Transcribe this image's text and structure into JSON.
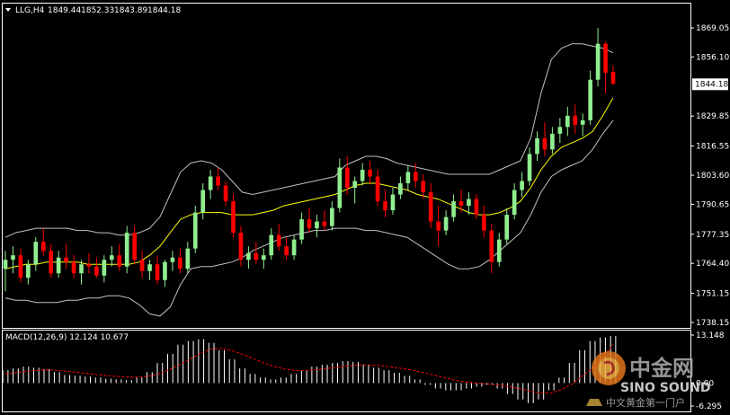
{
  "header": {
    "symbol": "LLG,H4",
    "open": "1849.44",
    "high": "1852.33",
    "low": "1843.89",
    "close": "1844.18"
  },
  "price_axis": {
    "ticks": [
      "1869.05",
      "1856.10",
      "1829.85",
      "1816.55",
      "1803.60",
      "1790.65",
      "1777.35",
      "1764.40",
      "1751.15",
      "1738.15"
    ],
    "current_price_label": "1844.18"
  },
  "macd_panel": {
    "title": "MACD(12,26,9) 12.124 10.677",
    "ticks": [
      "13.148",
      "0.00",
      "-6.295"
    ]
  },
  "watermark": {
    "cn_name": "中金网",
    "en_name": "SINO SOUND",
    "slogan": "中文黄金第一门户"
  },
  "colors": {
    "background": "#000000",
    "bull_candle": "#90ee90",
    "bear_candle": "#ff0000",
    "bollinger": "#c0c0c0",
    "moving_average": "#ffff00",
    "macd_hist": "#ffffff",
    "macd_signal": "#ff0000",
    "axis_text": "#ffffff",
    "current_price_box": "#ffffff"
  },
  "chart_data": {
    "type": "candlestick",
    "price_ylim": [
      1738.15,
      1869.05
    ],
    "ohlc": [
      [
        1762,
        1770,
        1752,
        1766
      ],
      [
        1766,
        1772,
        1760,
        1768
      ],
      [
        1768,
        1771,
        1756,
        1758
      ],
      [
        1758,
        1766,
        1755,
        1764
      ],
      [
        1764,
        1776,
        1761,
        1774
      ],
      [
        1774,
        1780,
        1768,
        1770
      ],
      [
        1770,
        1773,
        1758,
        1760
      ],
      [
        1760,
        1770,
        1758,
        1767
      ],
      [
        1767,
        1773,
        1762,
        1765
      ],
      [
        1765,
        1768,
        1758,
        1760
      ],
      [
        1760,
        1766,
        1755,
        1764
      ],
      [
        1764,
        1769,
        1760,
        1763
      ],
      [
        1763,
        1767,
        1758,
        1759
      ],
      [
        1759,
        1768,
        1756,
        1766
      ],
      [
        1766,
        1772,
        1763,
        1768
      ],
      [
        1768,
        1773,
        1761,
        1763
      ],
      [
        1763,
        1781,
        1760,
        1778
      ],
      [
        1778,
        1781,
        1764,
        1766
      ],
      [
        1766,
        1770,
        1758,
        1761
      ],
      [
        1761,
        1766,
        1757,
        1764
      ],
      [
        1764,
        1768,
        1755,
        1757
      ],
      [
        1757,
        1766,
        1754,
        1765
      ],
      [
        1765,
        1770,
        1761,
        1767
      ],
      [
        1767,
        1771,
        1760,
        1762
      ],
      [
        1762,
        1774,
        1760,
        1771
      ],
      [
        1771,
        1790,
        1769,
        1787
      ],
      [
        1787,
        1800,
        1784,
        1797
      ],
      [
        1797,
        1806,
        1793,
        1803
      ],
      [
        1803,
        1807,
        1797,
        1799
      ],
      [
        1799,
        1801,
        1790,
        1792
      ],
      [
        1792,
        1795,
        1776,
        1778
      ],
      [
        1778,
        1781,
        1763,
        1766
      ],
      [
        1766,
        1772,
        1762,
        1769
      ],
      [
        1769,
        1774,
        1764,
        1766
      ],
      [
        1766,
        1771,
        1762,
        1768
      ],
      [
        1768,
        1780,
        1766,
        1777
      ],
      [
        1777,
        1782,
        1770,
        1772
      ],
      [
        1772,
        1776,
        1766,
        1768
      ],
      [
        1768,
        1777,
        1766,
        1775
      ],
      [
        1775,
        1787,
        1773,
        1784
      ],
      [
        1784,
        1789,
        1778,
        1780
      ],
      [
        1780,
        1786,
        1776,
        1783
      ],
      [
        1783,
        1788,
        1779,
        1781
      ],
      [
        1781,
        1792,
        1779,
        1789
      ],
      [
        1789,
        1811,
        1787,
        1807
      ],
      [
        1807,
        1812,
        1795,
        1798
      ],
      [
        1798,
        1803,
        1791,
        1801
      ],
      [
        1801,
        1809,
        1799,
        1806
      ],
      [
        1806,
        1810,
        1800,
        1803
      ],
      [
        1803,
        1806,
        1790,
        1792
      ],
      [
        1792,
        1797,
        1785,
        1788
      ],
      [
        1788,
        1798,
        1786,
        1795
      ],
      [
        1795,
        1803,
        1793,
        1800
      ],
      [
        1800,
        1808,
        1797,
        1805
      ],
      [
        1805,
        1809,
        1798,
        1801
      ],
      [
        1801,
        1804,
        1793,
        1796
      ],
      [
        1796,
        1800,
        1780,
        1783
      ],
      [
        1783,
        1790,
        1772,
        1779
      ],
      [
        1779,
        1788,
        1777,
        1785
      ],
      [
        1785,
        1795,
        1783,
        1792
      ],
      [
        1792,
        1797,
        1787,
        1790
      ],
      [
        1790,
        1796,
        1786,
        1793
      ],
      [
        1793,
        1795,
        1784,
        1786
      ],
      [
        1786,
        1790,
        1776,
        1779
      ],
      [
        1779,
        1782,
        1760,
        1765
      ],
      [
        1765,
        1778,
        1763,
        1775
      ],
      [
        1775,
        1789,
        1773,
        1786
      ],
      [
        1786,
        1800,
        1784,
        1797
      ],
      [
        1797,
        1805,
        1794,
        1801
      ],
      [
        1801,
        1816,
        1799,
        1813
      ],
      [
        1813,
        1823,
        1810,
        1820
      ],
      [
        1820,
        1827,
        1812,
        1815
      ],
      [
        1815,
        1825,
        1813,
        1822
      ],
      [
        1822,
        1829,
        1818,
        1825
      ],
      [
        1825,
        1834,
        1821,
        1830
      ],
      [
        1830,
        1835,
        1822,
        1826
      ],
      [
        1826,
        1831,
        1821,
        1828
      ],
      [
        1828,
        1850,
        1826,
        1846
      ],
      [
        1846,
        1869,
        1843,
        1862
      ],
      [
        1862,
        1863,
        1840,
        1849
      ],
      [
        1849.44,
        1852.33,
        1843.89,
        1844.18
      ]
    ],
    "bollinger_upper": [
      1776,
      1778,
      1779,
      1780,
      1780,
      1780,
      1780,
      1779,
      1779,
      1778,
      1778,
      1777,
      1777,
      1778,
      1780,
      1785,
      1795,
      1805,
      1809,
      1810,
      1809,
      1806,
      1801,
      1796,
      1795,
      1796,
      1797,
      1798,
      1799,
      1800,
      1801,
      1802,
      1803,
      1808,
      1810,
      1812,
      1812,
      1811,
      1809,
      1808,
      1807,
      1806,
      1805,
      1804,
      1804,
      1804,
      1804,
      1804,
      1806,
      1808,
      1810,
      1820,
      1840,
      1855,
      1860,
      1862,
      1862,
      1861,
      1860,
      1858
    ],
    "bollinger_lower": [
      1749,
      1748,
      1748,
      1747,
      1747,
      1747,
      1748,
      1748,
      1749,
      1749,
      1750,
      1750,
      1749,
      1746,
      1742,
      1741,
      1745,
      1755,
      1762,
      1763,
      1763,
      1764,
      1765,
      1767,
      1770,
      1772,
      1774,
      1776,
      1777,
      1778,
      1779,
      1779,
      1780,
      1780,
      1780,
      1779,
      1779,
      1778,
      1777,
      1776,
      1773,
      1770,
      1767,
      1764,
      1762,
      1762,
      1763,
      1766,
      1770,
      1774,
      1778,
      1786,
      1796,
      1803,
      1806,
      1808,
      1810,
      1815,
      1822,
      1828
    ],
    "moving_average": [
      1762,
      1763,
      1764,
      1764,
      1765,
      1765,
      1765,
      1765,
      1764,
      1764,
      1764,
      1764,
      1764,
      1765,
      1768,
      1772,
      1778,
      1784,
      1786,
      1787,
      1787,
      1787,
      1786,
      1786,
      1786,
      1787,
      1788,
      1790,
      1791,
      1792,
      1793,
      1794,
      1795,
      1797,
      1799,
      1800,
      1800,
      1799,
      1798,
      1797,
      1795,
      1794,
      1793,
      1791,
      1789,
      1787,
      1786,
      1786,
      1787,
      1789,
      1792,
      1798,
      1806,
      1812,
      1816,
      1818,
      1820,
      1823,
      1830,
      1838
    ],
    "macd": {
      "params": "12,26,9",
      "values": [
        12.124,
        10.677
      ],
      "ylim": [
        -6.295,
        13.148
      ],
      "histogram": [
        3.5,
        4.0,
        4.5,
        4.2,
        3.8,
        3.0,
        2.2,
        2.0,
        1.8,
        1.5,
        1.2,
        1.0,
        0.8,
        1.5,
        3.0,
        5.5,
        8.0,
        10.5,
        11.5,
        12.0,
        11.0,
        9.0,
        6.5,
        4.0,
        2.5,
        1.5,
        1.0,
        1.5,
        2.5,
        3.5,
        4.5,
        5.0,
        5.5,
        6.0,
        5.8,
        5.0,
        4.2,
        3.5,
        2.8,
        2.0,
        1.0,
        -0.5,
        -1.5,
        -2.0,
        -2.0,
        -1.5,
        -1.0,
        -0.5,
        -1.5,
        -3.0,
        -4.5,
        -5.5,
        -4.5,
        -2.0,
        1.5,
        5.5,
        9.0,
        11.5,
        12.5,
        12.9
      ],
      "signal": [
        2.5,
        2.8,
        3.2,
        3.5,
        3.6,
        3.5,
        3.2,
        2.9,
        2.6,
        2.3,
        2.0,
        1.8,
        1.6,
        1.6,
        1.9,
        2.6,
        3.8,
        5.2,
        6.7,
        8.2,
        9.3,
        9.5,
        8.9,
        7.9,
        6.8,
        5.6,
        4.6,
        3.9,
        3.5,
        3.4,
        3.6,
        3.9,
        4.3,
        4.6,
        4.9,
        5.0,
        4.9,
        4.6,
        4.2,
        3.8,
        3.2,
        2.6,
        1.9,
        1.2,
        0.6,
        0.2,
        -0.1,
        -0.3,
        -0.6,
        -1.0,
        -1.6,
        -2.3,
        -2.8,
        -2.7,
        -1.8,
        -0.3,
        1.8,
        4.2,
        6.8,
        10.677
      ]
    }
  }
}
